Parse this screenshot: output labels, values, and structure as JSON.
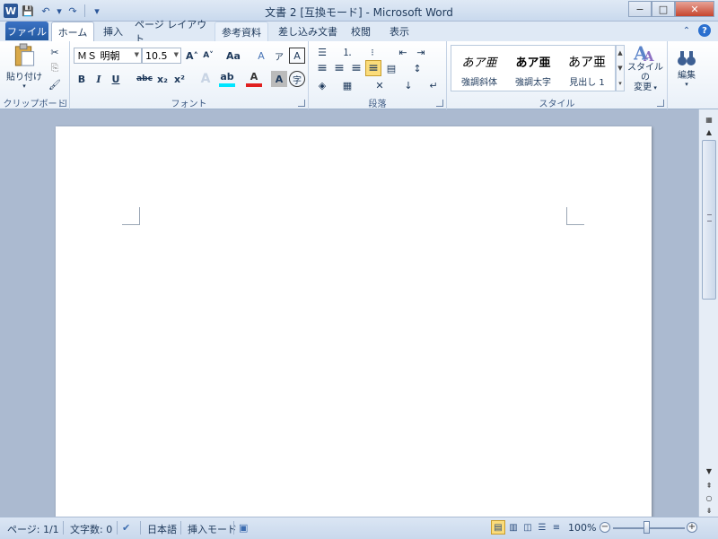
{
  "window": {
    "title": "文書 2 [互換モード] - Microsoft Word",
    "app_icon_letter": "W",
    "min": "−",
    "max": "□",
    "close": "✕"
  },
  "qat": {
    "save": "💾",
    "undo": "↶",
    "undo_dd": "▾",
    "redo": "↷",
    "customize": "▾"
  },
  "tabs": {
    "file": "ファイル",
    "items": [
      "ホーム",
      "挿入",
      "ページ レイアウト",
      "参考資料",
      "差し込み文書",
      "校閲",
      "表示"
    ],
    "minimize_ribbon": "⌃",
    "help": "?"
  },
  "clipboard": {
    "paste": "貼り付け",
    "paste_dd": "▾",
    "cut": "✂",
    "copy": "⎘",
    "format_painter": "🖌",
    "label": "クリップボード"
  },
  "font": {
    "name": "ＭＳ 明朝",
    "size": "10.5",
    "grow": "A˄",
    "shrink": "A˅",
    "change_case": "Aa",
    "clear_format": "A",
    "phonetic": "ア",
    "border_char": "A",
    "bold": "B",
    "italic": "I",
    "underline": "U",
    "strike": "abc",
    "sub": "x₂",
    "sup": "x²",
    "effects": "A",
    "highlight": "ab",
    "color": "A",
    "shading": "A",
    "enclose": "字",
    "label": "フォント"
  },
  "paragraph": {
    "bullets": "☰",
    "numbering": "⒈",
    "multilevel": "⁝",
    "dec_indent": "⇤",
    "inc_indent": "⇥",
    "align_left": "≡",
    "center": "≡",
    "align_right": "≡",
    "justify": "≡",
    "distributed": "▤",
    "line_spacing": "↕",
    "shading": "◈",
    "borders": "▦",
    "asian_layout": "✕",
    "sort": "↓",
    "marks": "↵",
    "label": "段落"
  },
  "styles": {
    "items": [
      {
        "sample": "あア亜",
        "name": "強調斜体"
      },
      {
        "sample": "あア亜",
        "name": "強調太字"
      },
      {
        "sample": "あア亜",
        "name": "見出し 1"
      }
    ],
    "change_styles": "スタイルの変更",
    "change_styles_line1": "スタイルの",
    "change_styles_line2": "変更",
    "label": "スタイル"
  },
  "editing": {
    "label": "編集"
  },
  "status": {
    "page": "ページ: 1/1",
    "words": "文字数: 0",
    "language": "日本語",
    "mode": "挿入モード",
    "zoom": "100%",
    "zoom_out": "−",
    "zoom_in": "+"
  }
}
